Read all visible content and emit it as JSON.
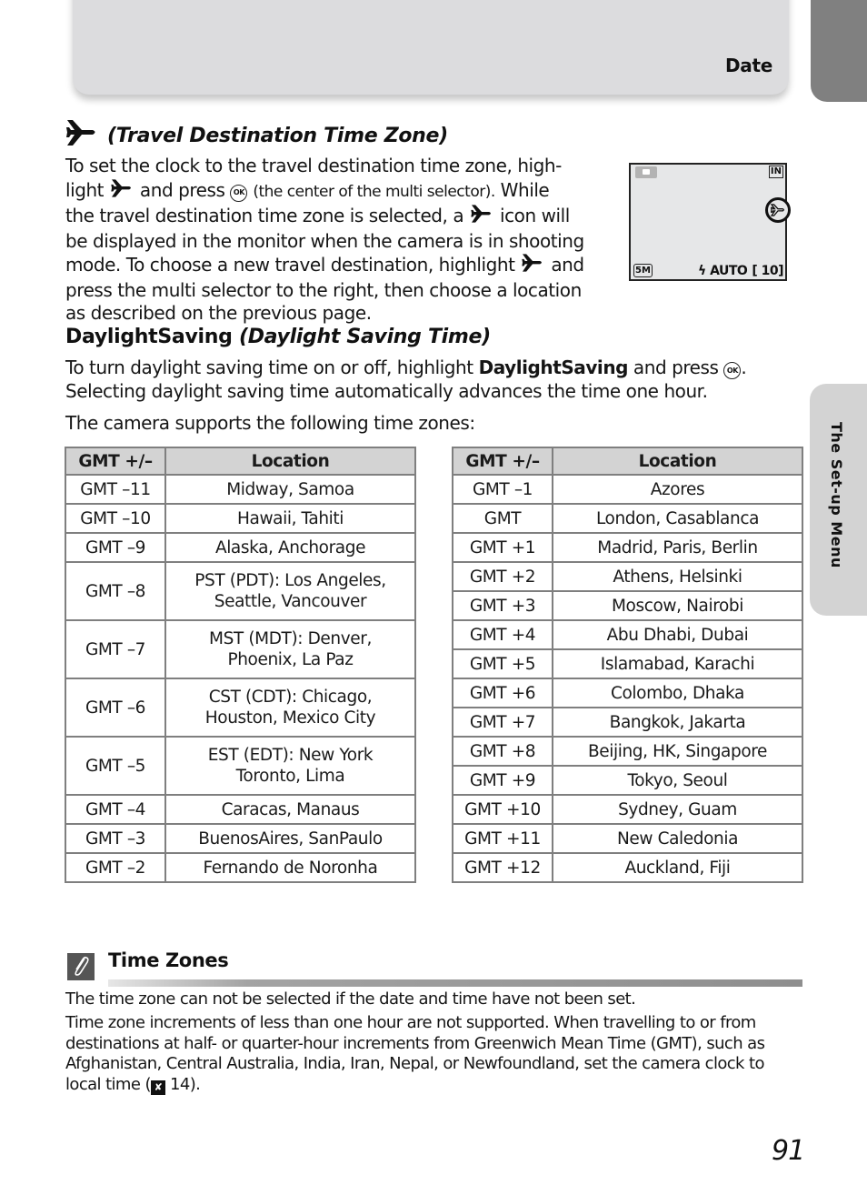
{
  "header": {
    "section_label": "Date"
  },
  "side_tab": {
    "label": "The Set-up Menu"
  },
  "travel_section": {
    "icon": "airplane-icon",
    "title": "(Travel Destination Time Zone)",
    "body": {
      "p1": "To set the clock to the travel destination time zone, high-",
      "p2a": "light",
      "p2b": "and press",
      "p2c": "(the center of the multi selector).",
      "p2d": "While",
      "p3a": "the travel destination time zone is selected, a",
      "p3b": "icon will",
      "p4": "be displayed in the monitor when the camera is in shooting",
      "p5a": "mode. To choose a new travel destination, highlight",
      "p5b": "and",
      "p6": "press the multi selector to the right, then choose a location",
      "p7": "as described on the previous page."
    },
    "ok_glyph": "OK"
  },
  "monitor": {
    "camera_icon": "camera-mode-icon",
    "memory_label": "IN",
    "travel_indicator": "airplane-icon",
    "image_size": "5M",
    "flash_label": "ϟ AUTO",
    "frames": "[ 10]"
  },
  "daylight_section": {
    "title_bold": "DaylightSaving",
    "title_italic": "(Daylight Saving Time)",
    "body_a": "To turn daylight saving time on or off, highlight",
    "body_bold": "DaylightSaving",
    "body_b": "and press",
    "body_c": ".",
    "body_line2": "Selecting daylight saving time automatically advances the time one hour.",
    "intro": "The camera supports the following time zones:"
  },
  "time_zone_tables": {
    "headers": [
      "GMT +/–",
      "Location"
    ],
    "left": [
      {
        "gmt": "GMT –11",
        "location": [
          "Midway, Samoa"
        ]
      },
      {
        "gmt": "GMT –10",
        "location": [
          "Hawaii, Tahiti"
        ]
      },
      {
        "gmt": "GMT –9",
        "location": [
          "Alaska, Anchorage"
        ]
      },
      {
        "gmt": "GMT –8",
        "location": [
          "PST (PDT): Los Angeles,",
          "Seattle, Vancouver"
        ]
      },
      {
        "gmt": "GMT –7",
        "location": [
          "MST (MDT): Denver,",
          "Phoenix, La Paz"
        ]
      },
      {
        "gmt": "GMT –6",
        "location": [
          "CST (CDT): Chicago,",
          "Houston, Mexico City"
        ]
      },
      {
        "gmt": "GMT –5",
        "location": [
          "EST (EDT): New York",
          "Toronto, Lima"
        ]
      },
      {
        "gmt": "GMT –4",
        "location": [
          "Caracas, Manaus"
        ]
      },
      {
        "gmt": "GMT –3",
        "location": [
          "BuenosAires, SanPaulo"
        ]
      },
      {
        "gmt": "GMT –2",
        "location": [
          "Fernando de Noronha"
        ]
      }
    ],
    "right": [
      {
        "gmt": "GMT –1",
        "location": [
          "Azores"
        ]
      },
      {
        "gmt": "GMT",
        "location": [
          "London, Casablanca"
        ]
      },
      {
        "gmt": "GMT +1",
        "location": [
          "Madrid, Paris, Berlin"
        ]
      },
      {
        "gmt": "GMT +2",
        "location": [
          "Athens, Helsinki"
        ]
      },
      {
        "gmt": "GMT +3",
        "location": [
          "Moscow, Nairobi"
        ]
      },
      {
        "gmt": "GMT +4",
        "location": [
          "Abu Dhabi, Dubai"
        ]
      },
      {
        "gmt": "GMT +5",
        "location": [
          "Islamabad, Karachi"
        ]
      },
      {
        "gmt": "GMT +6",
        "location": [
          "Colombo, Dhaka"
        ]
      },
      {
        "gmt": "GMT +7",
        "location": [
          "Bangkok, Jakarta"
        ]
      },
      {
        "gmt": "GMT +8",
        "location": [
          "Beijing, HK, Singapore"
        ]
      },
      {
        "gmt": "GMT +9",
        "location": [
          "Tokyo, Seoul"
        ]
      },
      {
        "gmt": "GMT +10",
        "location": [
          "Sydney, Guam"
        ]
      },
      {
        "gmt": "GMT +11",
        "location": [
          "New Caledonia"
        ]
      },
      {
        "gmt": "GMT +12",
        "location": [
          "Auckland, Fiji"
        ]
      }
    ]
  },
  "note": {
    "icon": "paperclip-note-icon",
    "title": "Time Zones",
    "line1": "The time zone can not be selected if the date and time have not been set.",
    "line2a": "Time zone increments of less than one hour are not supported. When travelling to or from destinations at half- or quarter-hour increments from Greenwich Mean Time (GMT), such as Afghanistan, Central Australia, India, Iran, Nepal, or Newfoundland, set the camera clock to local time (",
    "page_ref_icon": "page-reference-icon",
    "line2b": " 14)."
  },
  "page_number": "91"
}
